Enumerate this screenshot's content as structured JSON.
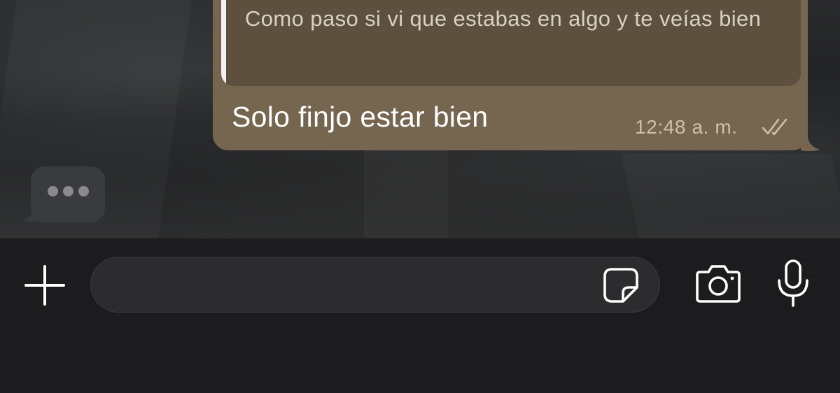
{
  "colors": {
    "outgoing_bubble": "#766650",
    "quote_background": "#5d503f",
    "input_bar_background": "#1c1c1e",
    "text_field_background": "#2c2c2e",
    "icon_color": "#ffffff"
  },
  "chat": {
    "outgoing_message": {
      "quoted_text": "Como paso si vi que estabas en algo y te veías bien",
      "text": "Solo finjo estar bien",
      "time": "12:48 a. m.",
      "status_icon": "double-check-icon"
    },
    "typing_indicator": {
      "icon": "ellipsis-icon"
    }
  },
  "input_bar": {
    "attach_icon": "plus-icon",
    "message_value": "",
    "message_placeholder": "",
    "sticker_icon": "sticker-icon",
    "camera_icon": "camera-icon",
    "mic_icon": "microphone-icon"
  }
}
